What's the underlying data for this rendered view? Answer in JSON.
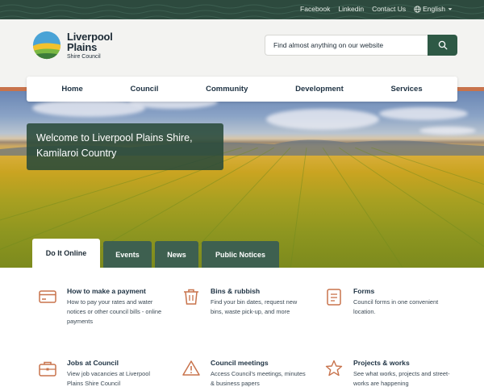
{
  "topbar": {
    "links": [
      "Facebook",
      "Linkedin",
      "Contact Us"
    ],
    "language": "English"
  },
  "logo": {
    "line1": "Liverpool",
    "line2": "Plains",
    "line3": "Shire Council"
  },
  "search": {
    "placeholder": "Find almost anything on our website"
  },
  "nav": [
    "Home",
    "Council",
    "Community",
    "Development",
    "Services"
  ],
  "hero": {
    "welcome": "Welcome to Liverpool Plains Shire, Kamilaroi Country"
  },
  "tabs": [
    "Do It Online",
    "Events",
    "News",
    "Public Notices"
  ],
  "cards": [
    {
      "title": "How to make a payment",
      "desc": "How to pay your rates and water notices or other council bills - online payments",
      "icon": "card-icon"
    },
    {
      "title": "Bins & rubbish",
      "desc": "Find your bin dates, request new bins, waste pick-up, and more",
      "icon": "bin-icon"
    },
    {
      "title": "Forms",
      "desc": "Council forms in one convenient location.",
      "icon": "form-icon"
    },
    {
      "title": "Jobs at Council",
      "desc": "View job vacancies at Liverpool Plains Shire Council",
      "icon": "briefcase-icon"
    },
    {
      "title": "Council meetings",
      "desc": "Access Council's meetings, minutes & business papers",
      "icon": "warning-icon"
    },
    {
      "title": "Projects & works",
      "desc": "See what works, projects and street-works are happening",
      "icon": "star-icon"
    }
  ],
  "colors": {
    "dark_green": "#2d4a3e",
    "accent_orange": "#c8734c",
    "button_green": "#2e5945"
  }
}
